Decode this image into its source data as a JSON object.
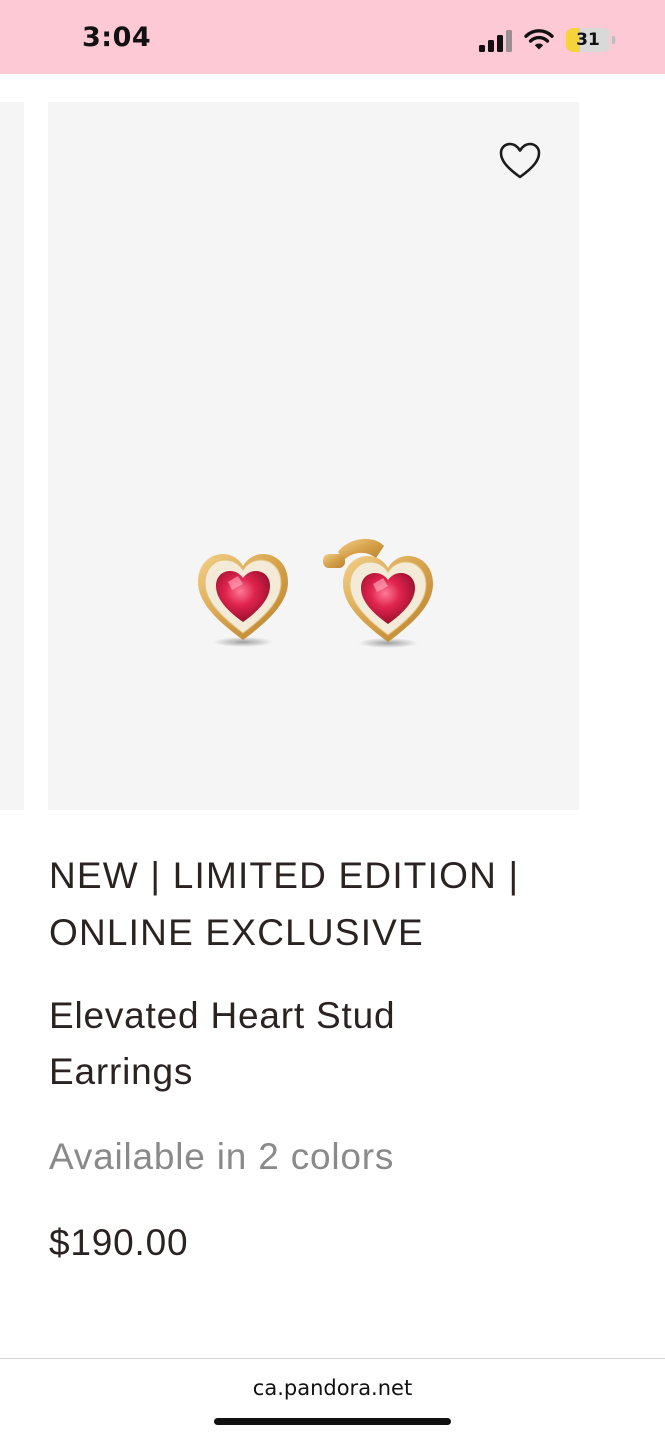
{
  "status_bar": {
    "time": "3:04",
    "battery_level": "31",
    "battery_fraction": 0.31,
    "background_color": "#fdc9d4",
    "battery_color": "#f6d33b"
  },
  "product": {
    "badge_line1": "NEW | LIMITED EDITION |",
    "badge_line2": "ONLINE EXCLUSIVE",
    "name_line1": "Elevated Heart Stud",
    "name_line2": "Earrings",
    "colors_text": "Available in 2 colors",
    "price": "$190.00",
    "wishlist_icon": "heart-outline-icon",
    "image_background": "#f5f5f5"
  },
  "browser": {
    "url": "ca.pandora.net"
  }
}
